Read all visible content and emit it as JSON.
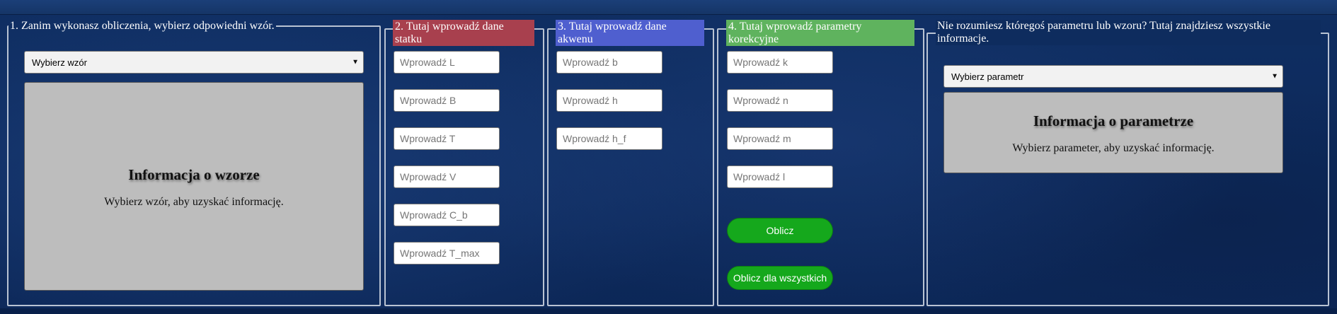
{
  "colors": {
    "background": "#0d2a5c",
    "panel_border": "#b9c3d3",
    "ship_header": "#a8404e",
    "basin_header": "#4f5fcf",
    "correction_header": "#5fb35e",
    "button": "#15a81c",
    "info_box": "#bdbdbd"
  },
  "formula_panel": {
    "legend": "1. Zanim wykonasz obliczenia, wybierz odpowiedni wzór.",
    "select_value": "Wybierz wzór",
    "info_title": "Informacja o wzorze",
    "info_text": "Wybierz wzór, aby uzyskać informację."
  },
  "ship_panel": {
    "legend": "2. Tutaj wprowadź dane statku",
    "inputs": [
      {
        "placeholder": "Wprowadź L"
      },
      {
        "placeholder": "Wprowadź B"
      },
      {
        "placeholder": "Wprowadź T"
      },
      {
        "placeholder": "Wprowadź V"
      },
      {
        "placeholder": "Wprowadź C_b"
      },
      {
        "placeholder": "Wprowadź T_max"
      }
    ]
  },
  "basin_panel": {
    "legend": "3. Tutaj wprowadź dane akwenu",
    "inputs": [
      {
        "placeholder": "Wprowadź b"
      },
      {
        "placeholder": "Wprowadź h"
      },
      {
        "placeholder": "Wprowadź h_f"
      }
    ]
  },
  "correction_panel": {
    "legend": "4. Tutaj wprowadź parametry korekcyjne",
    "inputs": [
      {
        "placeholder": "Wprowadź k"
      },
      {
        "placeholder": "Wprowadź n"
      },
      {
        "placeholder": "Wprowadź m"
      },
      {
        "placeholder": "Wprowadź l"
      }
    ],
    "calculate_label": "Oblicz",
    "calculate_all_label": "Oblicz dla wszystkich"
  },
  "help_panel": {
    "legend": "Nie rozumiesz któregoś parametru lub wzoru? Tutaj znajdziesz wszystkie informacje.",
    "select_value": "Wybierz parametr",
    "info_title": "Informacja o parametrze",
    "info_text": "Wybierz parameter, aby uzyskać informację."
  }
}
